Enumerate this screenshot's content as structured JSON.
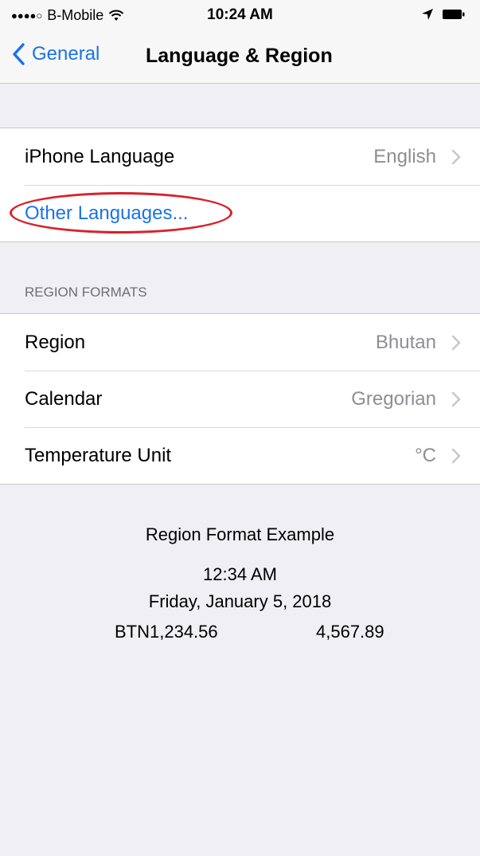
{
  "status_bar": {
    "signal": "●●●●○",
    "carrier": "B-Mobile",
    "time": "10:24 AM",
    "icons": [
      "wifi-icon",
      "location-icon",
      "battery-icon"
    ]
  },
  "nav": {
    "back_label": "General",
    "title": "Language & Region"
  },
  "language_group": {
    "iphone_language_label": "iPhone Language",
    "iphone_language_value": "English",
    "other_languages_label": "Other Languages..."
  },
  "region_section": {
    "header": "REGION FORMATS",
    "rows": [
      {
        "label": "Region",
        "value": "Bhutan"
      },
      {
        "label": "Calendar",
        "value": "Gregorian"
      },
      {
        "label": "Temperature Unit",
        "value": "°C"
      }
    ]
  },
  "example": {
    "title": "Region Format Example",
    "time": "12:34 AM",
    "date": "Friday, January 5, 2018",
    "currency": "BTN1,234.56",
    "number": "4,567.89"
  },
  "colors": {
    "accent": "#1a73e8",
    "background": "#efeff4",
    "highlight_ellipse": "#d8212b",
    "secondary_text": "#8e8e93"
  }
}
